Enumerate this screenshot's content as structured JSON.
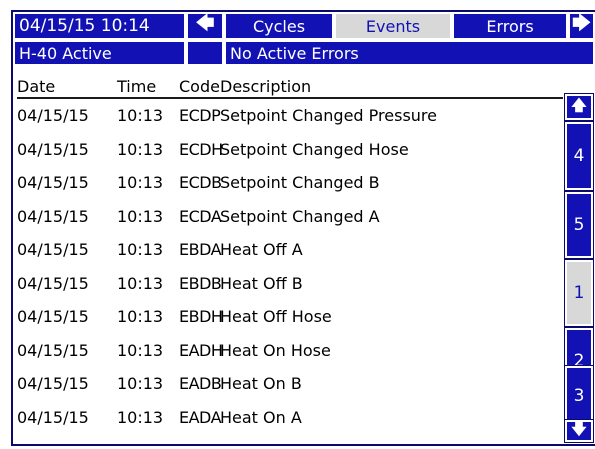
{
  "header": {
    "datetime": "04/15/15 10:14",
    "left_arrow": "🡄",
    "right_arrow": "🡆",
    "tabs": [
      {
        "label": "Cycles"
      },
      {
        "label": "Events"
      },
      {
        "label": "Errors"
      }
    ],
    "selected_tab": "Events"
  },
  "status": {
    "system": "H-40 Active",
    "indicator": "",
    "errors": "No Active Errors"
  },
  "table": {
    "columns": [
      "Date",
      "Time",
      "Code",
      "Description"
    ],
    "rows": [
      {
        "date": "04/15/15",
        "time": "10:13",
        "code": "ECDP",
        "description": "Setpoint Changed Pressure"
      },
      {
        "date": "04/15/15",
        "time": "10:13",
        "code": "ECDH",
        "description": "Setpoint Changed Hose"
      },
      {
        "date": "04/15/15",
        "time": "10:13",
        "code": "ECDB",
        "description": "Setpoint Changed B"
      },
      {
        "date": "04/15/15",
        "time": "10:13",
        "code": "ECDA",
        "description": "Setpoint Changed A"
      },
      {
        "date": "04/15/15",
        "time": "10:13",
        "code": "EBDA",
        "description": "Heat Off A"
      },
      {
        "date": "04/15/15",
        "time": "10:13",
        "code": "EBDB",
        "description": "Heat Off B"
      },
      {
        "date": "04/15/15",
        "time": "10:13",
        "code": "EBDH",
        "description": "Heat Off Hose"
      },
      {
        "date": "04/15/15",
        "time": "10:13",
        "code": "EADH",
        "description": "Heat On Hose"
      },
      {
        "date": "04/15/15",
        "time": "10:13",
        "code": "EADB",
        "description": "Heat On B"
      },
      {
        "date": "04/15/15",
        "time": "10:13",
        "code": "EADA",
        "description": "Heat On A"
      }
    ]
  },
  "scrollbar": {
    "up_arrow": "🡅",
    "down_arrow": "🡇",
    "pages": [
      "4",
      "5",
      "1",
      "2",
      "3"
    ],
    "selected_page": "1"
  },
  "colors": {
    "primary_blue": "#1212b4",
    "inactive_gray": "#d8d8d8",
    "text": "#000000"
  }
}
